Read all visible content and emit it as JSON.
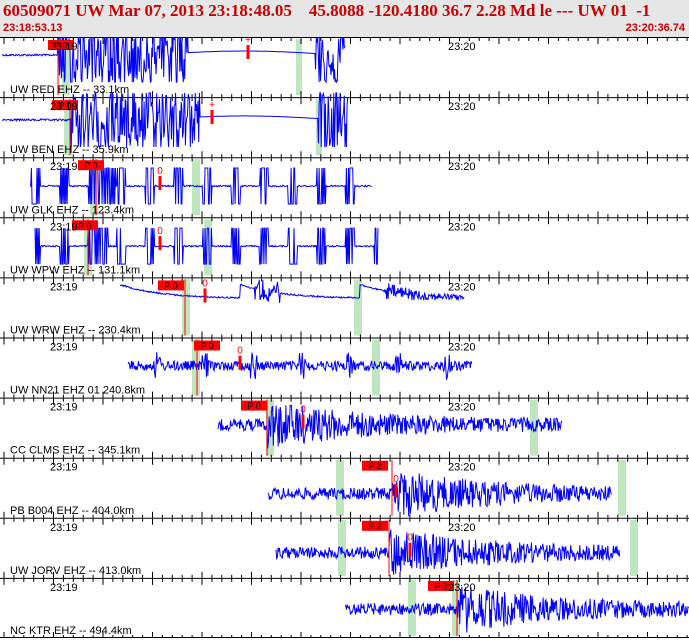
{
  "header": {
    "title": "60509071 UW Mar 07, 2013 23:18:48.05    45.8088 -120.4180 36.7 2.28 Md le --- UW 01  -1",
    "start_time": "23:18:53.13",
    "end_time": "23:20:36.74"
  },
  "colors": {
    "trace": "#0000ff",
    "pick": "#ff0000",
    "header_text": "#c80000",
    "gap": "#bfe6bf",
    "header_bg": "#e6e6e6"
  },
  "chart_data": {
    "type": "waveform",
    "time_start": "23:18:53.13",
    "time_end": "23:20:36.74",
    "channels": [
      {
        "label": "UW RED EHZ -- 33.1km",
        "minute_labels": [
          "23:19",
          "23:20"
        ],
        "pick_label": "P 0",
        "s_label": "+"
      },
      {
        "label": "UW BEN EHZ -- 35.9km",
        "minute_labels": [
          "23:19",
          "23:20"
        ],
        "pick_label": "P 0",
        "s_label": "+"
      },
      {
        "label": "UW GLK EHZ -- 123.4km",
        "minute_labels": [
          "23:19",
          "23:20"
        ],
        "pick_label": "P 0",
        "s_label": "0"
      },
      {
        "label": "UW WPW EHZ -- 131.1km",
        "minute_labels": [
          "23:19",
          "23:20"
        ],
        "pick_label": "P 0",
        "s_label": "0"
      },
      {
        "label": "UW WRW EHZ -- 230.4km",
        "minute_labels": [
          "23:19",
          "23:20"
        ],
        "pick_label": "P 0",
        "s_label": "0"
      },
      {
        "label": "UW NN21 EHZ 01 240.8km",
        "minute_labels": [
          "23:19",
          "23:20"
        ],
        "pick_label": "P 0",
        "s_label": "0"
      },
      {
        "label": "CC CLMS EHZ -- 345.1km",
        "minute_labels": [
          "23:19",
          "23:20"
        ],
        "pick_label": "P 0",
        "s_label": "0"
      },
      {
        "label": "PB B004 EHZ -- 404.0km",
        "minute_labels": [
          "23:19",
          "23:20"
        ],
        "pick_label": "P 2",
        "s_label": "0"
      },
      {
        "label": "UW JORV EHZ -- 413.0km",
        "minute_labels": [
          "23:19",
          "23:20"
        ],
        "pick_label": "P 2",
        "s_label": "0"
      },
      {
        "label": "NC KTR EHZ -- 494.4km",
        "minute_labels": [
          "23:19",
          "23:20"
        ],
        "pick_label": "P 2",
        "s_label": ""
      }
    ]
  }
}
